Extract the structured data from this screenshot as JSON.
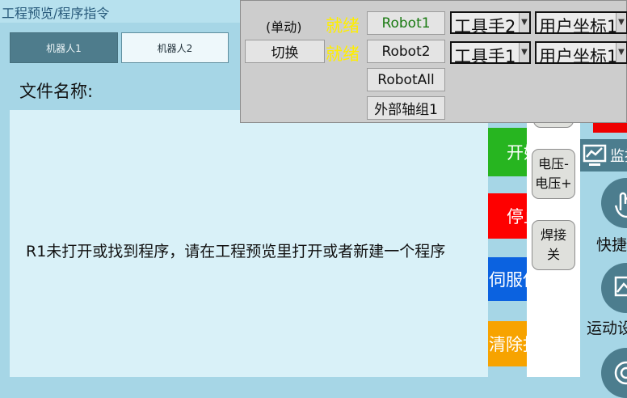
{
  "header": {
    "title": "工程预览/程序指令"
  },
  "robot_tabs": [
    {
      "label": "机器人1",
      "active": true
    },
    {
      "label": "机器人2",
      "active": false
    }
  ],
  "file": {
    "label": "文件名称:"
  },
  "editor": {
    "message": "R1未打开或找到程序，请在工程预览里打开或者新建一个程序"
  },
  "actions": {
    "start": "开始",
    "stop": "停止",
    "servo": "伺服使能",
    "clear": "清除报警"
  },
  "weld_buttons": {
    "voltage": [
      "电压-",
      "电压+"
    ],
    "weld_off": [
      "焊接",
      "关"
    ]
  },
  "monitor": {
    "label": "监控"
  },
  "right_labels": {
    "quick": "快捷",
    "motion": "运动设置"
  },
  "panel": {
    "mode": "(单动)",
    "switch_button": "切换",
    "status": [
      "就绪",
      "就绪"
    ],
    "robot_buttons": [
      "Robot1",
      "Robot2",
      "RobotAll",
      "外部轴组1"
    ],
    "tool_selects": [
      "工具手2",
      "工具手1"
    ],
    "coord_selects": [
      "用户坐标1",
      "用户坐标1"
    ]
  },
  "colors": {
    "start": "#27b520",
    "stop": "#fe0000",
    "servo": "#0b62e0",
    "clear": "#f7a300",
    "ready": "#ffee00",
    "robot1_text": "#1a7a12"
  },
  "icons": [
    "monitor-icon",
    "hand-touch-icon",
    "motion-settings-icon",
    "gauge-icon",
    "dropdown-arrow-icon"
  ]
}
